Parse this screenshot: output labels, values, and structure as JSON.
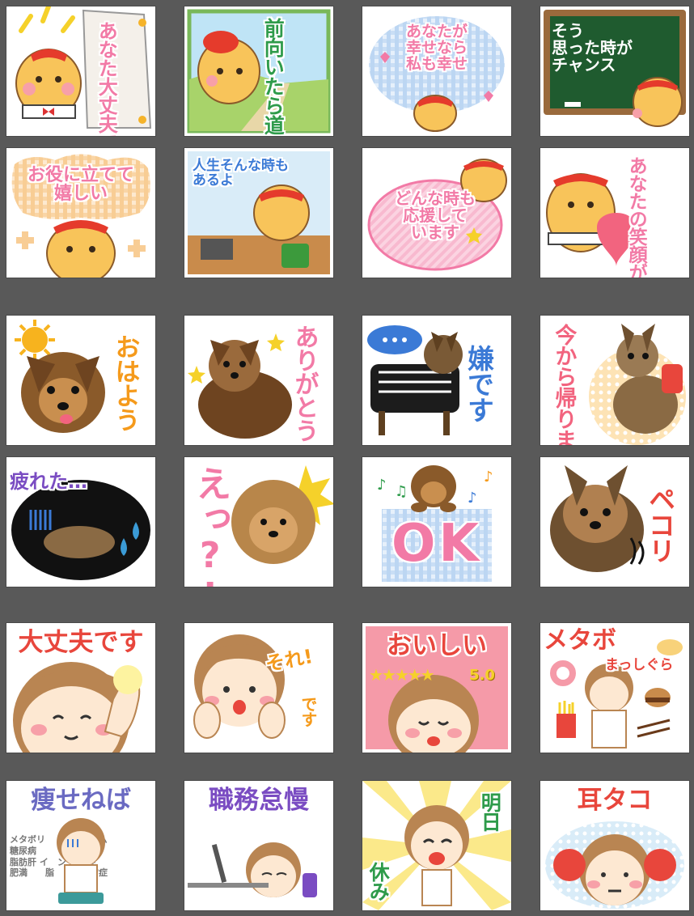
{
  "stickers": {
    "s1": {
      "text": "あなた大丈夫では"
    },
    "s2": {
      "text": "前向きに道はあるよ",
      "vertical": "前向いたら道はある"
    },
    "s3": {
      "text": "あなたが\n幸せなら\n私も幸せ"
    },
    "s4": {
      "text": "そう\n思った時が\nチャンス"
    },
    "s5": {
      "text": "お役に立てて\n嬉しい"
    },
    "s6": {
      "text": "人生そんな時も\nあるよ"
    },
    "s7": {
      "text": "どんな時も\n応援して\nいます"
    },
    "s8": {
      "text": "あなたの笑顔が好き"
    },
    "s9": {
      "text": "おはよう"
    },
    "s10": {
      "text": "ありがとう"
    },
    "s11": {
      "text": "嫌です"
    },
    "s12": {
      "text": "今から帰ります"
    },
    "s13": {
      "text": "疲れた…"
    },
    "s14": {
      "text": "えっ?!"
    },
    "s15": {
      "text": "OK"
    },
    "s16": {
      "text": "ペコリ"
    },
    "s17": {
      "text": "大丈夫です"
    },
    "s18": {
      "text": "それ!",
      "sub": "です"
    },
    "s19": {
      "text": "おいしい",
      "rating": "5.0",
      "stars": 5
    },
    "s20": {
      "text": "メタボ",
      "sub": "まっしぐら"
    },
    "s21": {
      "text": "痩せねば",
      "bg_words": "メタボリ　　　ドローム\n糖尿病　　　　高血圧\n脂肪肝 イ　ン 抵抗性\n肥満　　脂　　謝異常症"
    },
    "s22": {
      "text": "職務怠慢"
    },
    "s23": {
      "text": "明日",
      "sub": "休み"
    },
    "s24": {
      "text": "耳タコ"
    }
  },
  "colors": {
    "background": "#595959",
    "pink": "#f27aa6",
    "green": "#2e9b4a",
    "blue": "#3b7ad6",
    "orange": "#f59a1b",
    "red": "#e8463c",
    "purple": "#7a4cc2",
    "blackboard": "#1f5b2f"
  }
}
